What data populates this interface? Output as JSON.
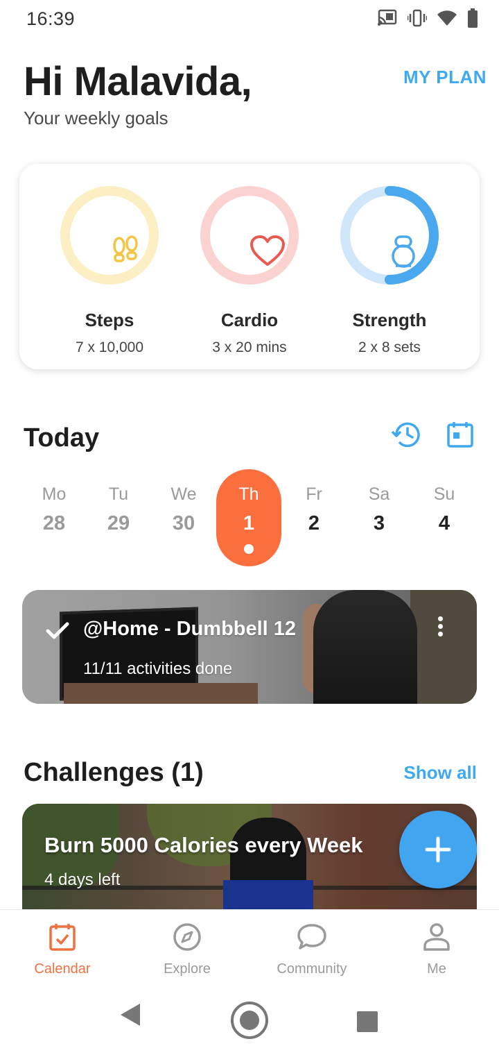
{
  "status_bar": {
    "time": "16:39",
    "icons": [
      "cast-icon",
      "vibrate-icon",
      "wifi-icon",
      "battery-icon"
    ]
  },
  "header": {
    "greeting": "Hi Malavida,",
    "subtitle": "Your weekly goals",
    "my_plan": "MY PLAN"
  },
  "goals": [
    {
      "name": "Steps",
      "target": "7 x 10,000",
      "icon": "footsteps-icon",
      "color": "#f4c542",
      "progress": 0
    },
    {
      "name": "Cardio",
      "target": "3 x 20 mins",
      "icon": "heart-icon",
      "color": "#e8594f",
      "progress": 0
    },
    {
      "name": "Strength",
      "target": "2 x 8 sets",
      "icon": "kettlebell-icon",
      "color": "#4aa8ef",
      "progress": 0.5
    }
  ],
  "today": {
    "title": "Today",
    "icons": [
      "history-icon",
      "calendar-icon"
    ],
    "days": [
      {
        "name": "Mo",
        "num": "28",
        "state": "past"
      },
      {
        "name": "Tu",
        "num": "29",
        "state": "past"
      },
      {
        "name": "We",
        "num": "30",
        "state": "past"
      },
      {
        "name": "Th",
        "num": "1",
        "state": "active"
      },
      {
        "name": "Fr",
        "num": "2",
        "state": "future"
      },
      {
        "name": "Sa",
        "num": "3",
        "state": "future"
      },
      {
        "name": "Su",
        "num": "4",
        "state": "future"
      }
    ]
  },
  "workout": {
    "title": "@Home - Dumbbell 12",
    "subtitle": "11/11 activities done"
  },
  "challenges": {
    "title": "Challenges (1)",
    "show_all": "Show all",
    "card": {
      "title": "Burn 5000 Calories every Week",
      "subtitle": "4 days left"
    }
  },
  "bottom_nav": [
    {
      "label": "Calendar",
      "icon": "calendar-check-icon",
      "active": true
    },
    {
      "label": "Explore",
      "icon": "compass-icon",
      "active": false
    },
    {
      "label": "Community",
      "icon": "chat-bubble-icon",
      "active": false
    },
    {
      "label": "Me",
      "icon": "person-icon",
      "active": false
    }
  ],
  "colors": {
    "accent_orange": "#fb6f3f",
    "accent_blue": "#3fa9f0"
  }
}
